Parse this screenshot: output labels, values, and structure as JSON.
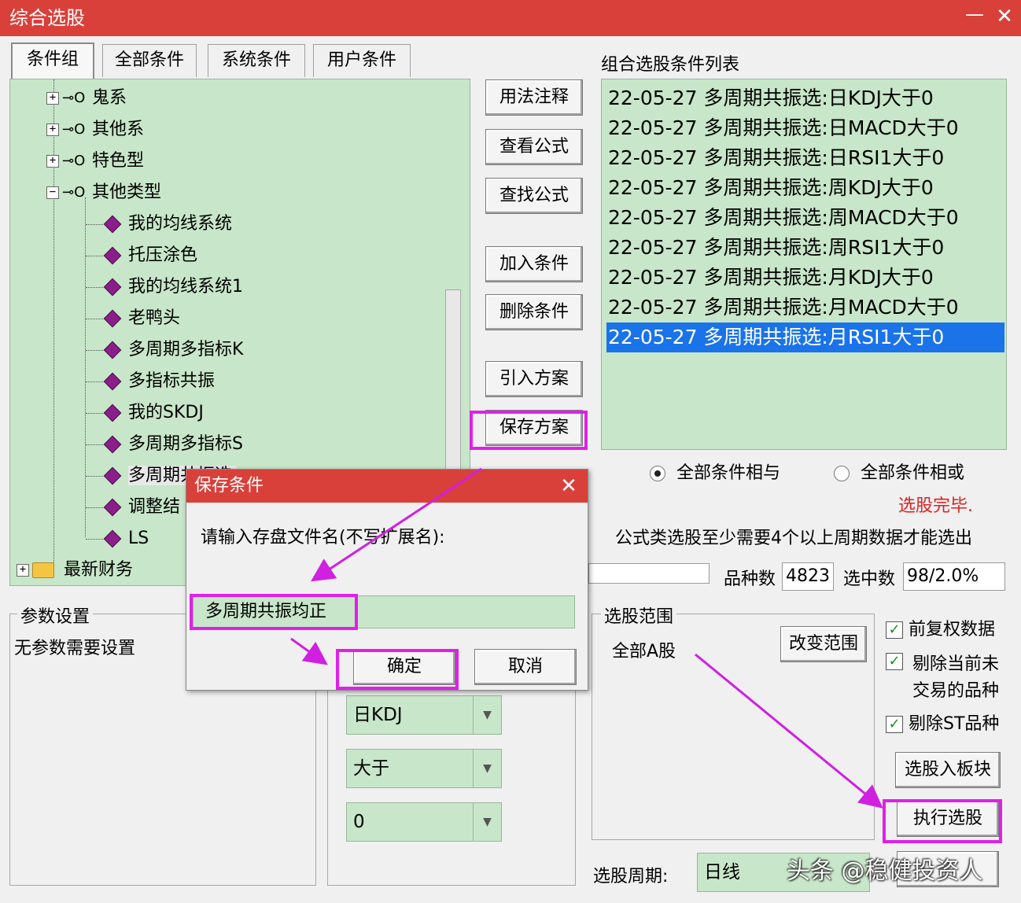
{
  "window": {
    "title": "综合选股",
    "minimize": "—",
    "close": "✕"
  },
  "tabs": [
    "条件组",
    "全部条件",
    "系统条件",
    "用户条件"
  ],
  "tree": {
    "groups": [
      {
        "label": "鬼系",
        "expander": "+"
      },
      {
        "label": "其他系",
        "expander": "+"
      },
      {
        "label": "特色型",
        "expander": "+"
      },
      {
        "label": "其他类型",
        "expander": "−"
      }
    ],
    "items": [
      "我的均线系统",
      "托压涂色",
      "我的均线系统1",
      "老鸭头",
      "多周期多指标K",
      "多指标共振",
      "我的SKDJ",
      "多周期多指标S",
      "多周期共振选",
      "调整结",
      "LS"
    ],
    "folder": {
      "label": "最新财务",
      "expander": "+"
    }
  },
  "buttons": {
    "usage": "用法注释",
    "view_formula": "查看公式",
    "find_formula": "查找公式",
    "add_cond": "加入条件",
    "del_cond": "删除条件",
    "import_plan": "引入方案",
    "save_plan": "保存方案",
    "change_range": "改变范围",
    "to_block": "选股入板块",
    "execute": "执行选股"
  },
  "condition_list": {
    "title": "组合选股条件列表",
    "items": [
      "22-05-27 多周期共振选:日KDJ大于0",
      "22-05-27 多周期共振选:日MACD大于0",
      "22-05-27 多周期共振选:日RSI1大于0",
      "22-05-27 多周期共振选:周KDJ大于0",
      "22-05-27 多周期共振选:周MACD大于0",
      "22-05-27 多周期共振选:周RSI1大于0",
      "22-05-27 多周期共振选:月KDJ大于0",
      "22-05-27 多周期共振选:月MACD大于0",
      "22-05-27 多周期共振选:月RSI1大于0"
    ],
    "selected_index": 8
  },
  "logic": {
    "and_label": "全部条件相与",
    "or_label": "全部条件相或",
    "selected": "and"
  },
  "status": {
    "done": "选股完毕.",
    "note": "公式类选股至少需要4个以上周期数据才能选出",
    "count_label": "品种数",
    "count_value": "4823",
    "selected_label": "选中数",
    "selected_value": "98/2.0%",
    "done_color": "#e02020"
  },
  "params": {
    "title": "参数设置",
    "text": "无参数需要设置"
  },
  "combos": {
    "indicator": "日KDJ",
    "operator": "大于",
    "value": "0"
  },
  "range": {
    "title": "选股范围",
    "value": "全部A股"
  },
  "options": {
    "fq": {
      "label": "前复权数据",
      "checked": true
    },
    "no_trade": {
      "label": "剔除当前未交易的品种",
      "checked": true
    },
    "st": {
      "label": "剔除ST品种",
      "checked": true
    }
  },
  "period": {
    "label": "选股周期:",
    "value": "日线"
  },
  "watermark": "头条 @稳健投资人",
  "dialog": {
    "title": "保存条件",
    "close": "✕",
    "prompt": "请输入存盘文件名(不写扩展名):",
    "input_value": "多周期共振均正",
    "ok": "确定",
    "cancel": "取消"
  },
  "colors": {
    "title_bar": "#d9403a",
    "panel_green": "#c8e6c9",
    "selection": "#1a73e8",
    "annotation": "#e020e8"
  }
}
